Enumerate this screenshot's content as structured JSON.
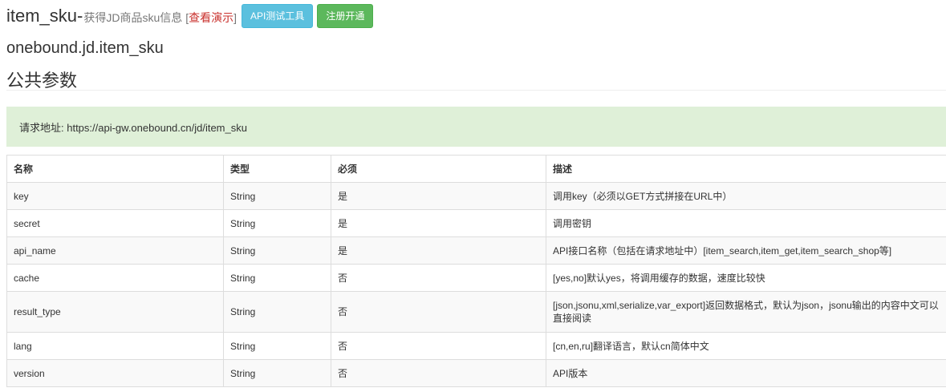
{
  "header": {
    "title": "item_sku-",
    "subtitle": "获得JD商品sku信息",
    "bracket_open": "[",
    "demo_link": "查看演示",
    "bracket_close": "]",
    "api_test_button": "API测试工具",
    "register_button": "注册开通"
  },
  "method_name": "onebound.jd.item_sku",
  "section_title": "公共参数",
  "request_url": "请求地址: https://api-gw.onebound.cn/jd/item_sku",
  "table": {
    "headers": [
      "名称",
      "类型",
      "必须",
      "描述"
    ],
    "rows": [
      [
        "key",
        "String",
        "是",
        "调用key（必须以GET方式拼接在URL中）"
      ],
      [
        "secret",
        "String",
        "是",
        "调用密钥"
      ],
      [
        "api_name",
        "String",
        "是",
        "API接口名称（包括在请求地址中）[item_search,item_get,item_search_shop等]"
      ],
      [
        "cache",
        "String",
        "否",
        "[yes,no]默认yes，将调用缓存的数据，速度比较快"
      ],
      [
        "result_type",
        "String",
        "否",
        "[json,jsonu,xml,serialize,var_export]返回数据格式，默认为json，jsonu输出的内容中文可以直接阅读"
      ],
      [
        "lang",
        "String",
        "否",
        "[cn,en,ru]翻译语言，默认cn简体中文"
      ],
      [
        "version",
        "String",
        "否",
        "API版本"
      ]
    ]
  },
  "colors": {
    "link_red": "#c9302c",
    "info_button": "#5bc0de",
    "success_button": "#5cb85c",
    "alert_bg": "#dff0d8"
  }
}
